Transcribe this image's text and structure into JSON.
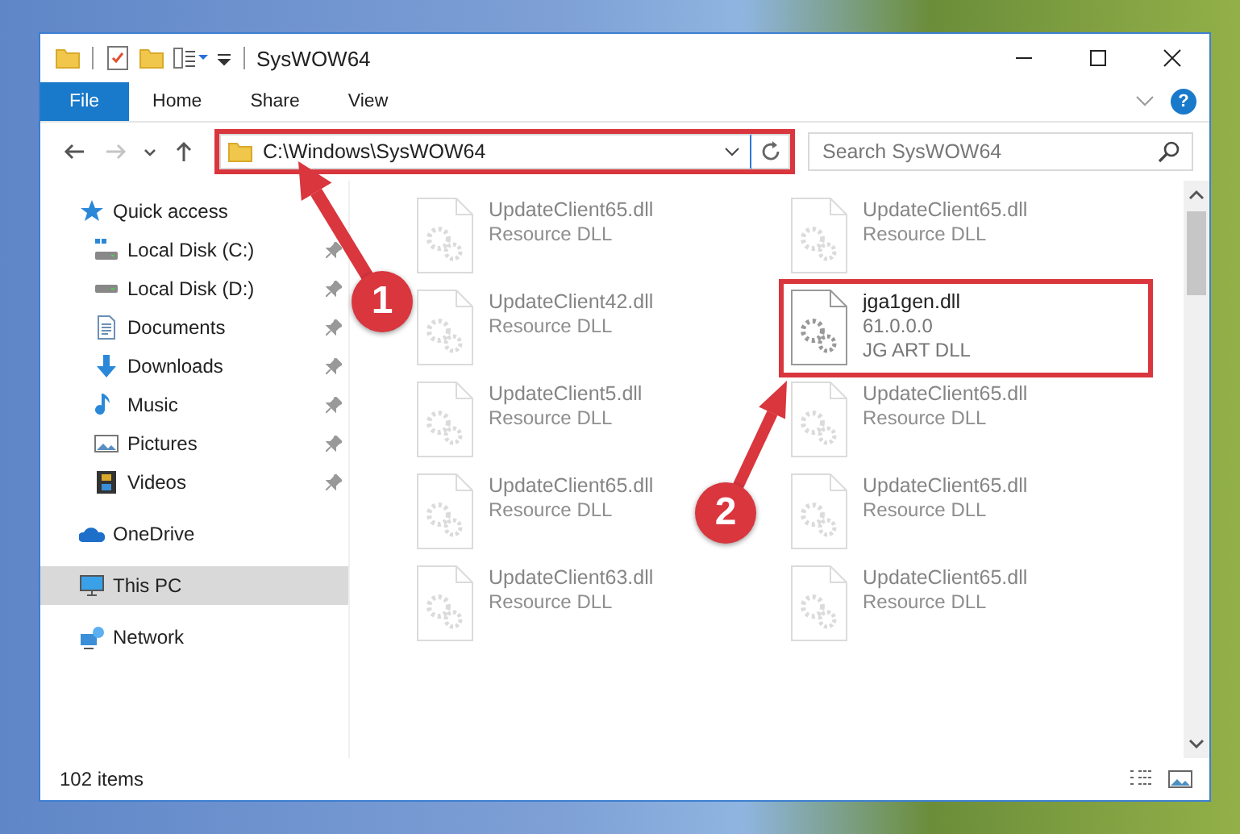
{
  "window": {
    "title": "SysWOW64"
  },
  "ribbon_tabs": [
    {
      "label": "File",
      "kind": "file"
    },
    {
      "label": "Home",
      "kind": "tab"
    },
    {
      "label": "Share",
      "kind": "tab"
    },
    {
      "label": "View",
      "kind": "tab"
    }
  ],
  "help": {
    "label": "?"
  },
  "nav_buttons": [
    {
      "kind": "back",
      "disabled": false
    },
    {
      "kind": "forward",
      "disabled": true
    },
    {
      "kind": "recent",
      "disabled": false
    },
    {
      "kind": "up",
      "disabled": false
    }
  ],
  "address": {
    "path": "C:\\Windows\\SysWOW64",
    "highlighted": true
  },
  "search": {
    "placeholder": "Search SysWOW64"
  },
  "sidebar": {
    "items": [
      {
        "label": "Quick access",
        "kind": "quick",
        "selected": false,
        "children": [
          {
            "label": "Local Disk (C:)",
            "kind": "system-disk",
            "pinned": true,
            "selected": false
          },
          {
            "label": "Local Disk (D:)",
            "kind": "disk",
            "pinned": true,
            "selected": false
          },
          {
            "label": "Documents",
            "kind": "documents",
            "pinned": true,
            "selected": false
          },
          {
            "label": "Downloads",
            "kind": "downloads",
            "pinned": true,
            "selected": false
          },
          {
            "label": "Music",
            "kind": "music",
            "pinned": true,
            "selected": false
          },
          {
            "label": "Pictures",
            "kind": "pictures",
            "pinned": true,
            "selected": false
          },
          {
            "label": "Videos",
            "kind": "videos",
            "pinned": true,
            "selected": false
          }
        ]
      },
      {
        "label": "OneDrive",
        "kind": "cloud",
        "selected": false
      },
      {
        "label": "This PC",
        "kind": "pc",
        "selected": true
      },
      {
        "label": "Network",
        "kind": "network",
        "selected": false
      }
    ]
  },
  "files": {
    "columns": [
      {
        "items": [
          {
            "name": "UpdateClient65.dll",
            "details": [
              "Resource DLL"
            ],
            "faded": true,
            "highlighted": false
          },
          {
            "name": "UpdateClient42.dll",
            "details": [
              "Resource DLL"
            ],
            "faded": true,
            "highlighted": false
          },
          {
            "name": "UpdateClient5.dll",
            "details": [
              "Resource DLL"
            ],
            "faded": true,
            "highlighted": false
          },
          {
            "name": "UpdateClient65.dll",
            "details": [
              "Resource DLL"
            ],
            "faded": true,
            "highlighted": false
          },
          {
            "name": "UpdateClient63.dll",
            "details": [
              "Resource DLL"
            ],
            "faded": true,
            "highlighted": false
          }
        ]
      },
      {
        "items": [
          {
            "name": "UpdateClient65.dll",
            "details": [
              "Resource DLL"
            ],
            "faded": true,
            "highlighted": false
          },
          {
            "name": "jga1gen.dll",
            "details": [
              "61.0.0.0",
              "JG ART DLL"
            ],
            "faded": false,
            "highlighted": true
          },
          {
            "name": "UpdateClient65.dll",
            "details": [
              "Resource DLL"
            ],
            "faded": true,
            "highlighted": false
          },
          {
            "name": "UpdateClient65.dll",
            "details": [
              "Resource DLL"
            ],
            "faded": true,
            "highlighted": false
          },
          {
            "name": "UpdateClient65.dll",
            "details": [
              "Resource DLL"
            ],
            "faded": true,
            "highlighted": false
          }
        ]
      }
    ]
  },
  "annotations": [
    {
      "number": "1"
    },
    {
      "number": "2"
    }
  ],
  "status_bar": {
    "item_count": "102 items"
  }
}
